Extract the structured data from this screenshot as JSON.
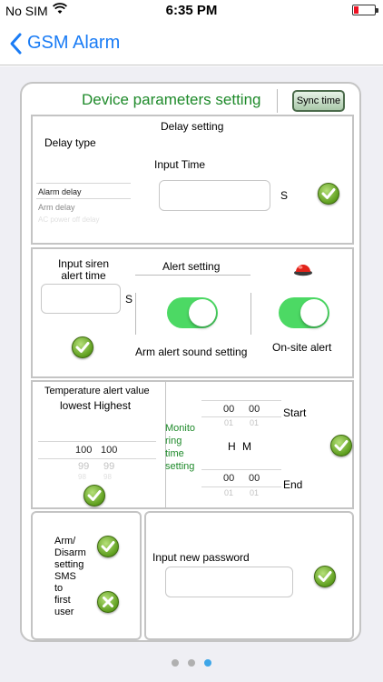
{
  "status": {
    "carrier": "No SIM",
    "time": "6:35 PM",
    "wifi_icon": "wifi-icon",
    "battery_icon": "battery-low-icon",
    "battery_color": "#ee1122"
  },
  "nav": {
    "title": "GSM Alarm",
    "back_icon": "chevron-left-icon",
    "accent": "#1a7cf5"
  },
  "card": {
    "title": "Device parameters setting",
    "sync_label": "Sync time",
    "title_color": "#1e8a2a"
  },
  "delay": {
    "heading": "Delay setting",
    "type_label": "Delay type",
    "input_time_label": "Input Time",
    "unit": "S",
    "options": [
      "Alarm delay",
      "Arm delay",
      "AC power off delay"
    ],
    "input_value": ""
  },
  "alert": {
    "siren_label": "Input siren alert time",
    "siren_unit": "S",
    "heading": "Alert setting",
    "arm_sound_label": "Arm alert sound setting",
    "onsite_label": "On-site alert",
    "arm_sound_on": true,
    "onsite_on": true,
    "siren_icon": "red-alarm-light-icon"
  },
  "temperature": {
    "heading": "Temperature alert value",
    "subheading": "lowest Highest",
    "picker_rows": [
      [
        "100",
        "100"
      ],
      [
        "99",
        "99"
      ],
      [
        "98",
        "98"
      ]
    ]
  },
  "monitoring": {
    "label": "Monito ring time setting",
    "label_lines": [
      "Monito",
      "ring",
      "time",
      "setting"
    ],
    "start_label": "Start",
    "end_label": "End",
    "h_label": "H",
    "m_label": "M",
    "start_rows": [
      [
        "00",
        "00"
      ],
      [
        "01",
        "01"
      ]
    ],
    "end_rows": [
      [
        "00",
        "00"
      ],
      [
        "01",
        "01"
      ]
    ]
  },
  "sms": {
    "label_lines": [
      "Arm/",
      "Disarm",
      "setting",
      "SMS",
      "to",
      "first",
      "user"
    ]
  },
  "password": {
    "label": "Input new password",
    "value": ""
  },
  "pager": {
    "count": 3,
    "active_index": 2
  }
}
